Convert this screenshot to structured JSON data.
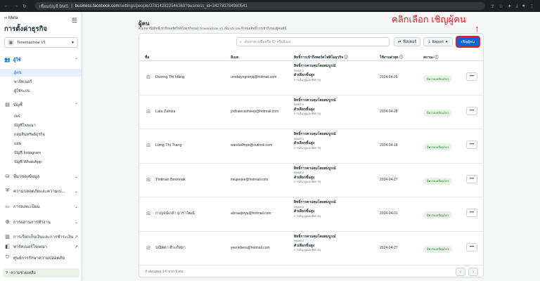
{
  "browser": {
    "tab_name": "เชื่อมบัญชี BMS",
    "url_host": "business.facebook.com",
    "url_path": "/settings/people/378142822546369?business_id=342783784980541"
  },
  "sidebar": {
    "meta_label": "Meta",
    "title": "การตั้งค่าธุรกิจ",
    "account": "Timemachine V1",
    "sections": [
      {
        "label": "ผู้ใช้",
        "icon": "users-icon"
      },
      {
        "label": "บัญชี",
        "icon": "accounts-icon"
      },
      {
        "label": "ที่มาของข้อมูล",
        "icon": "data-sources-icon"
      },
      {
        "label": "ความปลอดภัยและความเป...",
        "icon": "shield-icon"
      },
      {
        "label": "การลงทะเบียน",
        "icon": "registration-icon"
      },
      {
        "label": "การผสานการทำงาน",
        "icon": "integrations-icon"
      },
      {
        "label": "การเรียกเก็บเงินและการชำระเงิน",
        "icon": "billing-icon"
      },
      {
        "label": "พาร์ทเนอร์โฆษณา",
        "icon": "ad-partners-icon"
      },
      {
        "label": "ศูนย์การรักษาความปลอดภัย",
        "icon": "security-center-icon"
      }
    ],
    "users_items": [
      "ผู้คน",
      "พาร์ทเนอร์",
      "ผู้ใช้ระบบ"
    ],
    "account_items": [
      "เพจ",
      "บัญชีโฆษณา",
      "กลุ่มสินทรัพย์ธุรกิจ",
      "แอพ",
      "บัญชี Instagram",
      "บัญชี WhatsApp"
    ],
    "help": "ความช่วยเหลือ"
  },
  "page": {
    "title": "ผู้คน",
    "subtitle": "คนเหล่านี้มีสิทธิ์เข้าถึงพอร์ตโฟลิโอธุรกิจของ Timemachine V1 เพิ่ม แบ และกำหนดสิทธิ์การเข้าถึงของผู้คนที่นี่",
    "annotation": "คลิกเลือก เชิญผู้คน"
  },
  "toolbar": {
    "search_placeholder": "ค้นหาตามชื่อหรือ ID หรืออีเมล",
    "filter_label": "ฟิลเตอร์",
    "export_label": "Export",
    "invite_label": "เชิญผู้คน"
  },
  "table": {
    "headers": [
      "ชื่อ",
      "อีเมล",
      "สิทธิ์การเข้าถึงพอร์ตโฟลิโอธุรกิจ",
      "ใช้งานล่าสุด",
      "สถานะ"
    ],
    "rows": [
      {
        "name": "Dương Thị Hằng",
        "email": "urretaiyngrenjq@hotmail.com",
        "perm1": "สิทธิ์การควบคุมโดยสมบูรณ์",
        "perm1_sub": "ทุกอย่าง",
        "perm2": "ตัวเลือกขั้นสูง",
        "perm2_sub": "การเงิน (ดูและจัดการ)",
        "last": "2024-04-26",
        "status": "มีความเคลื่อนไหว"
      },
      {
        "name": "Lala Zahwa",
        "email": "jodhaiecashieep@hotmail.com",
        "perm1": "สิทธิ์การควบคุมโดยสมบูรณ์",
        "perm1_sub": "ทุกอย่าง",
        "perm2": "ตัวเลือกขั้นสูง",
        "perm2_sub": "การเงิน (ดูและจัดการ)",
        "last": "2024-04-28",
        "status": "มีความเคลื่อนไหว"
      },
      {
        "name": "Lừng Thị Trang",
        "email": "wanda4fnpe@outlook.com",
        "perm1": "สิทธิ์การควบคุมโดยสมบูรณ์",
        "perm1_sub": "ทุกอย่าง",
        "perm2": "ตัวเลือกขั้นสูง",
        "perm2_sub": "การเงิน (ดูและจัดการ)",
        "last": "2024-04-18",
        "status": "มีความเคลื่อนไหว"
      },
      {
        "name": "Thitinan Boonnak",
        "email": "imujeejee@hotmail.com",
        "perm1": "สิทธิ์การควบคุมโดยสมบูรณ์",
        "perm1_sub": "ทุกอย่าง",
        "perm2": "ตัวเลือกขั้นสูง",
        "perm2_sub": "การเงิน (ดูและจัดการ)",
        "last": "2024-04-27",
        "status": "มีความเคลื่อนไหว"
      },
      {
        "name": "กาญจน์เกล้า ดาราวัฒน์",
        "email": "alzraaljorya@hotmail.com",
        "perm1": "สิทธิ์การควบคุมโดยสมบูรณ์",
        "perm1_sub": "ทุกอย่าง",
        "perm2": "ตัวเลือกขั้นสูง",
        "perm2_sub": "การเงิน (ดูและจัดการ)",
        "last": "2024-04-01",
        "status": "มีความเคลื่อนไหว"
      },
      {
        "name": "ปณิตตา ศิวะกัลยา",
        "email": "yeeriebera@hotmail.com",
        "perm1": "สิทธิ์การควบคุมโดยสมบูรณ์",
        "perm1_sub": "ทุกอย่าง",
        "perm2": "ตัวเลือกขั้นสูง",
        "perm2_sub": "การเงิน (ดูและจัดการ)",
        "last": "2024-04-27",
        "status": "มีความเคลื่อนไหว"
      }
    ],
    "footer": "กำลังแสดง 1-6 จาก 6 คน"
  },
  "colors": {
    "accent": "#0a66d8",
    "annotation": "#e0202b",
    "status_bg": "#e6f4e3"
  }
}
